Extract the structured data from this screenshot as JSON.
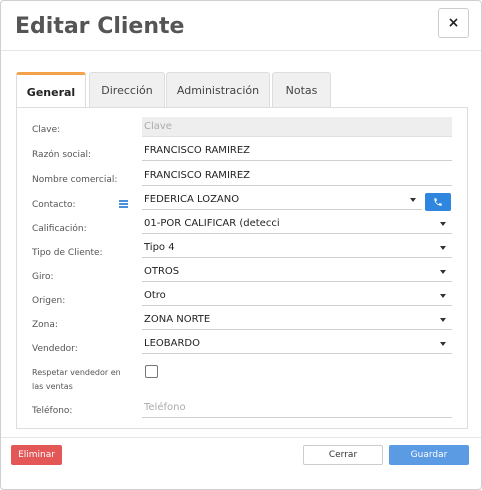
{
  "modal": {
    "title": "Editar Cliente",
    "close_symbol": "×"
  },
  "tabs": [
    {
      "label": "General"
    },
    {
      "label": "Dirección"
    },
    {
      "label": "Administración"
    },
    {
      "label": "Notas"
    }
  ],
  "form": {
    "clave": {
      "label": "Clave:",
      "placeholder": "Clave"
    },
    "razon_social": {
      "label": "Razón social:",
      "value": "FRANCISCO RAMIREZ"
    },
    "nombre_comercial": {
      "label": "Nombre comercial:",
      "value": "FRANCISCO RAMIREZ"
    },
    "contacto": {
      "label": "Contacto:",
      "value": "FEDERICA LOZANO"
    },
    "calificacion": {
      "label": "Calificación:",
      "value": "01-POR CALIFICAR (detecci"
    },
    "tipo_cliente": {
      "label": "Tipo de Cliente:",
      "value": "Tipo 4"
    },
    "giro": {
      "label": "Giro:",
      "value": "OTROS"
    },
    "origen": {
      "label": "Origen:",
      "value": "Otro"
    },
    "zona": {
      "label": "Zona:",
      "value": "ZONA NORTE"
    },
    "vendedor": {
      "label": "Vendedor:",
      "value": "LEOBARDO"
    },
    "respetar_vendedor": {
      "label_line1": "Respetar vendedor en",
      "label_line2": "las ventas"
    },
    "telefono": {
      "label": "Teléfono:",
      "placeholder": "Teléfono"
    }
  },
  "footer": {
    "delete_label": "Eliminar",
    "close_label": "Cerrar",
    "save_label": "Guardar"
  },
  "colors": {
    "active_tab_accent": "#f3a24a",
    "primary": "#5a9be3",
    "danger": "#e45757",
    "phone_button": "#2e86de"
  }
}
